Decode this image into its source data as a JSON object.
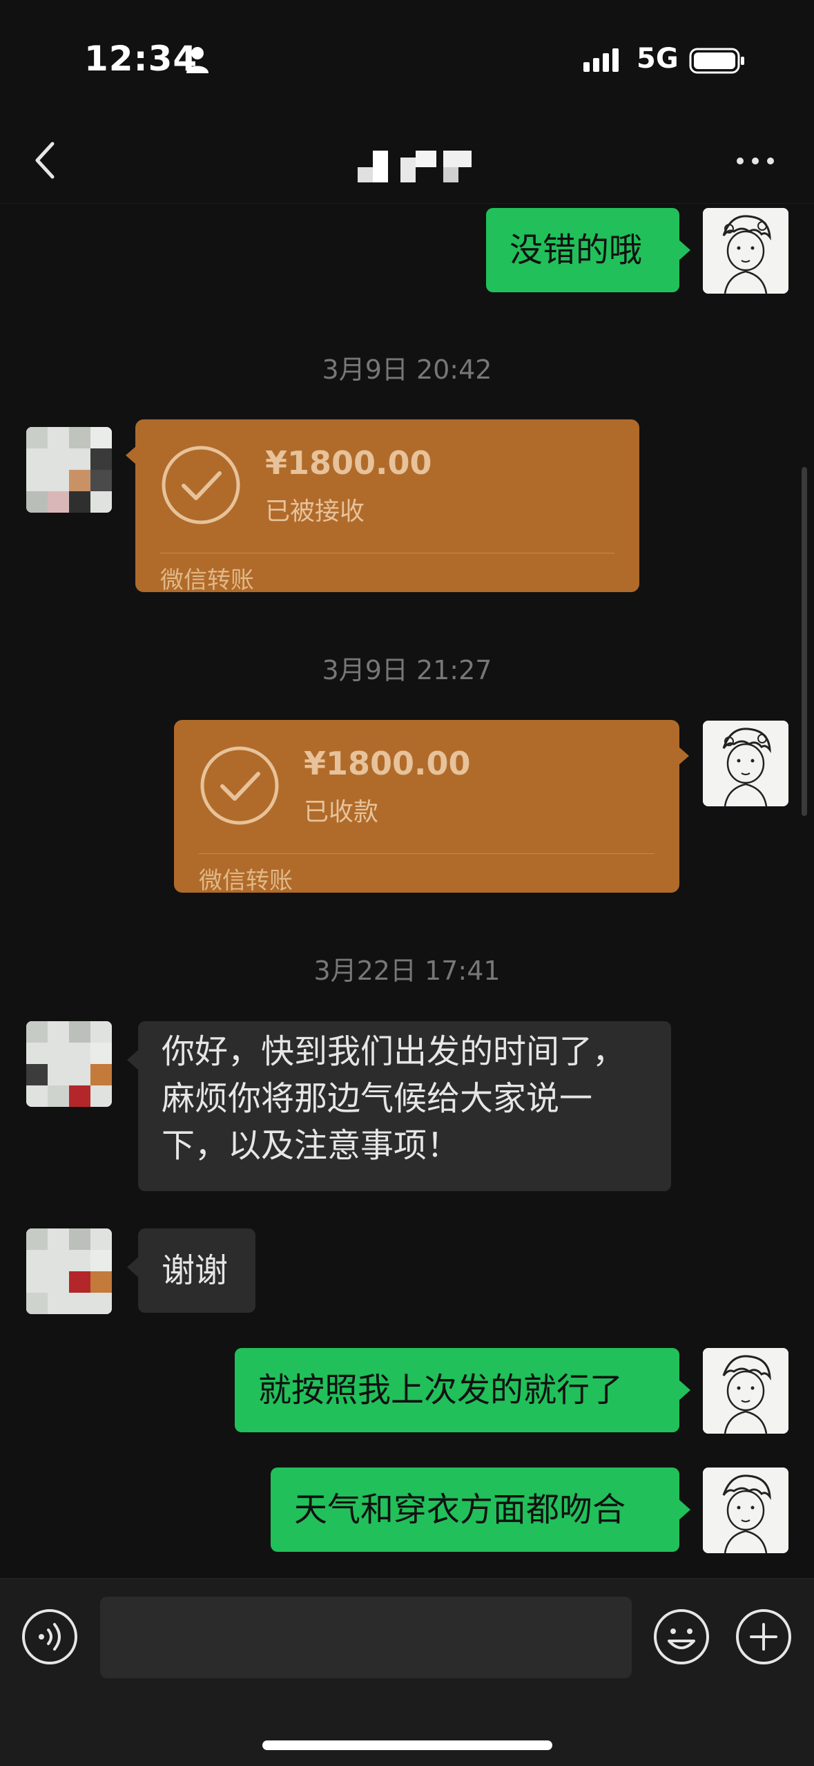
{
  "status_bar": {
    "time": "12:34",
    "network": "5G"
  },
  "nav": {
    "title": ""
  },
  "messages": [
    {
      "type": "text",
      "side": "right",
      "text": "没错的哦"
    },
    {
      "type": "timestamp",
      "text": "3月9日 20:42"
    },
    {
      "type": "transfer",
      "side": "left",
      "amount": "¥1800.00",
      "status": "已被接收",
      "label": "微信转账"
    },
    {
      "type": "timestamp",
      "text": "3月9日 21:27"
    },
    {
      "type": "transfer",
      "side": "right",
      "amount": "¥1800.00",
      "status": "已收款",
      "label": "微信转账"
    },
    {
      "type": "timestamp",
      "text": "3月22日 17:41"
    },
    {
      "type": "text",
      "side": "left",
      "lines": [
        "你好，快到我们出发的时间了，",
        "麻烦你将那边气候给大家说一",
        "下，以及注意事项！"
      ]
    },
    {
      "type": "text",
      "side": "left",
      "text": "谢谢"
    },
    {
      "type": "text",
      "side": "right",
      "text": "就按照我上次发的就行了"
    },
    {
      "type": "text",
      "side": "right",
      "text": "天气和穿衣方面都吻合"
    }
  ],
  "input": {
    "placeholder": ""
  },
  "colors": {
    "sent_bubble": "#21c05a",
    "received_bubble": "#2c2c2c",
    "transfer": "#b06b2a",
    "background": "#111111"
  },
  "icons": [
    "person-icon",
    "signal-icon",
    "battery-icon",
    "back-icon",
    "more-icon",
    "check-icon",
    "voice-icon",
    "emoji-icon",
    "plus-icon"
  ]
}
